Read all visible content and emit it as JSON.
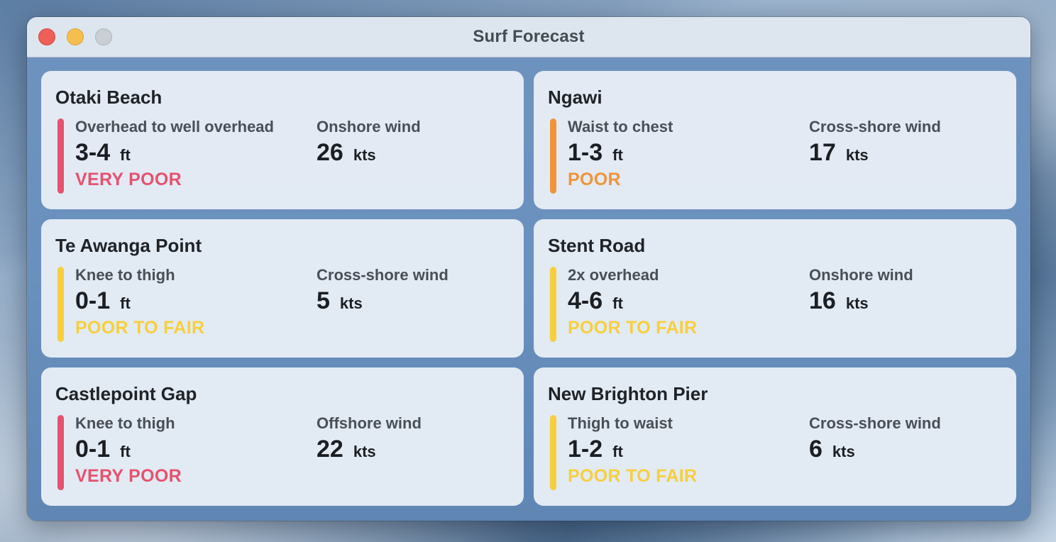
{
  "window": {
    "title": "Surf Forecast"
  },
  "colors": {
    "very_poor": "#e5526e",
    "poor": "#f0943a",
    "poor_to_fair": "#f7cf3e"
  },
  "spots": [
    {
      "name": "Otaki Beach",
      "surf_desc": "Overhead to well overhead",
      "height": "3-4",
      "height_unit": "ft",
      "wind_desc": "Onshore wind",
      "wind_speed": "26",
      "wind_unit": "kts",
      "rating": "VERY POOR",
      "rating_color": "#e5526e"
    },
    {
      "name": "Ngawi",
      "surf_desc": "Waist to chest",
      "height": "1-3",
      "height_unit": "ft",
      "wind_desc": "Cross-shore wind",
      "wind_speed": "17",
      "wind_unit": "kts",
      "rating": "POOR",
      "rating_color": "#f0943a"
    },
    {
      "name": "Te Awanga Point",
      "surf_desc": "Knee to thigh",
      "height": "0-1",
      "height_unit": "ft",
      "wind_desc": "Cross-shore wind",
      "wind_speed": "5",
      "wind_unit": "kts",
      "rating": "POOR TO FAIR",
      "rating_color": "#f7cf3e"
    },
    {
      "name": "Stent Road",
      "surf_desc": "2x overhead",
      "height": "4-6",
      "height_unit": "ft",
      "wind_desc": "Onshore wind",
      "wind_speed": "16",
      "wind_unit": "kts",
      "rating": "POOR TO FAIR",
      "rating_color": "#f7cf3e"
    },
    {
      "name": "Castlepoint Gap",
      "surf_desc": "Knee to thigh",
      "height": "0-1",
      "height_unit": "ft",
      "wind_desc": "Offshore wind",
      "wind_speed": "22",
      "wind_unit": "kts",
      "rating": "VERY POOR",
      "rating_color": "#e5526e"
    },
    {
      "name": "New Brighton Pier",
      "surf_desc": "Thigh to waist",
      "height": "1-2",
      "height_unit": "ft",
      "wind_desc": "Cross-shore wind",
      "wind_speed": "6",
      "wind_unit": "kts",
      "rating": "POOR TO FAIR",
      "rating_color": "#f7cf3e"
    }
  ]
}
